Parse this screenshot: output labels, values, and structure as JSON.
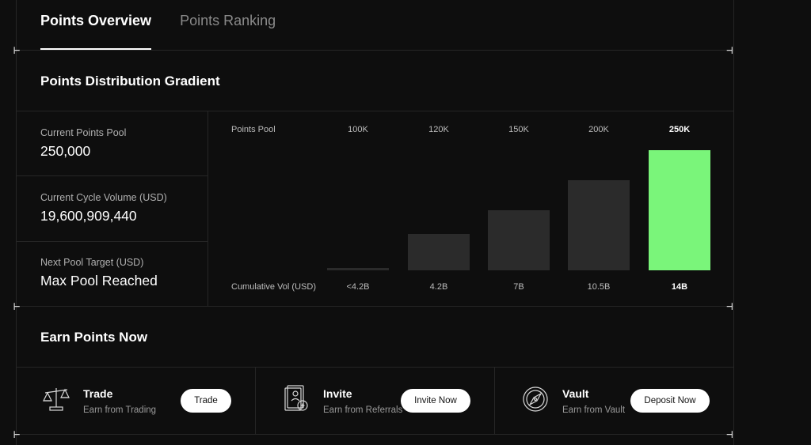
{
  "tabs": [
    {
      "label": "Points Overview",
      "active": true
    },
    {
      "label": "Points Ranking",
      "active": false
    }
  ],
  "distribution": {
    "title": "Points Distribution Gradient"
  },
  "stats": [
    {
      "label": "Current Points Pool",
      "value": "250,000"
    },
    {
      "label": "Current Cycle Volume (USD)",
      "value": "19,600,909,440"
    },
    {
      "label": "Next Pool Target (USD)",
      "value": "Max Pool Reached"
    }
  ],
  "chart_data": {
    "type": "bar",
    "row_label_top": "Points Pool",
    "row_label_bottom": "Cumulative Vol (USD)",
    "categories_top": [
      "100K",
      "120K",
      "150K",
      "200K",
      "250K"
    ],
    "categories_bottom": [
      "<4.2B",
      "4.2B",
      "7B",
      "10.5B",
      "14B"
    ],
    "values": [
      0.02,
      0.3,
      0.5,
      0.75,
      1.0
    ],
    "highlight_index": 4,
    "highlight_color": "#7af57a",
    "bar_color": "#2b2b2b"
  },
  "earn": {
    "title": "Earn Points Now",
    "items": [
      {
        "title": "Trade",
        "subtitle": "Earn from Trading",
        "button": "Trade",
        "icon": "scale-icon"
      },
      {
        "title": "Invite",
        "subtitle": "Earn from Referrals",
        "button": "Invite Now",
        "icon": "invite-card-icon"
      },
      {
        "title": "Vault",
        "subtitle": "Earn from Vault",
        "button": "Deposit Now",
        "icon": "compass-vault-icon"
      }
    ]
  },
  "colors": {
    "background": "#0e0e0e",
    "accent": "#7af57a",
    "border": "#262626"
  }
}
